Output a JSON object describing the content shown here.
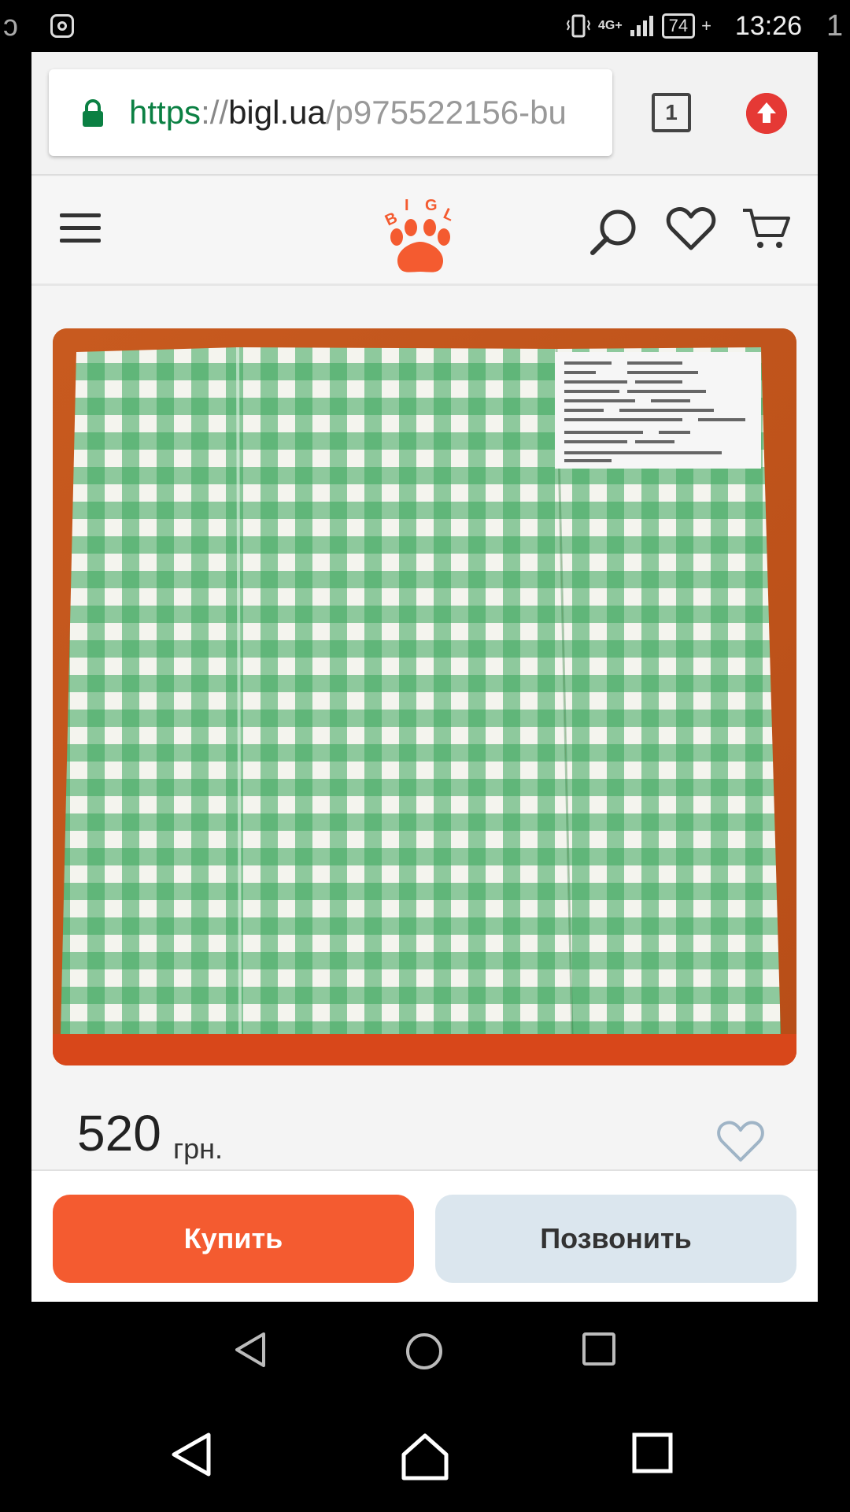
{
  "status_bar": {
    "network": "4G+",
    "battery": "74",
    "time": "13:26",
    "icons": [
      "instagram-icon",
      "vibrate-icon",
      "signal-icon",
      "battery-icon"
    ]
  },
  "browser": {
    "url_scheme": "https",
    "url_separator": "://",
    "url_host": "bigl.ua",
    "url_path": "/p975522156-bu",
    "tab_count": "1",
    "colors": {
      "secure": "#0b8043",
      "update": "#e53935"
    }
  },
  "site_header": {
    "logo_text": "BIGL",
    "icons": [
      "menu-icon",
      "search-icon",
      "heart-icon",
      "cart-icon"
    ],
    "colors": {
      "brand": "#f45b30"
    }
  },
  "product": {
    "price": "520",
    "currency": "грн."
  },
  "actions": {
    "buy_label": "Купить",
    "call_label": "Позвонить",
    "colors": {
      "buy": "#f45b30",
      "call": "#dbe6ee"
    }
  },
  "nav": {
    "icons": [
      "back-icon",
      "home-icon",
      "recents-icon"
    ]
  }
}
